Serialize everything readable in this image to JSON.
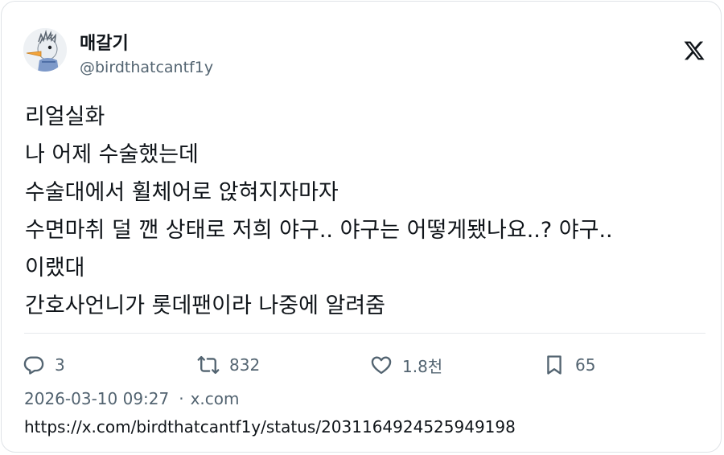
{
  "author": {
    "display_name": "매갈기",
    "handle": "@birdthatcantf1y"
  },
  "platform_icon": "x-logo-icon",
  "tweet": {
    "lines": [
      "리얼실화",
      "나 어제 수술했는데",
      "수술대에서 휠체어로 앉혀지자마자",
      "수면마취 덜 깬 상태로 저희 야구.. 야구는 어떻게됐나요..? 야구..",
      "이랬대",
      "간호사언니가 롯데팬이라 나중에 알려줌"
    ]
  },
  "actions": {
    "reply": {
      "icon": "reply-icon",
      "count": "3"
    },
    "retweet": {
      "icon": "retweet-icon",
      "count": "832"
    },
    "like": {
      "icon": "heart-icon",
      "count": "1.8천"
    },
    "bookmark": {
      "icon": "bookmark-icon",
      "count": "65"
    }
  },
  "meta": {
    "timestamp": "2026-03-10 09:27",
    "separator": "·",
    "source": "x.com"
  },
  "url": "https://x.com/birdthatcantf1y/status/2031164924525949198",
  "colors": {
    "text": "#0f1419",
    "secondary": "#536471",
    "border": "#dfe3e7"
  }
}
